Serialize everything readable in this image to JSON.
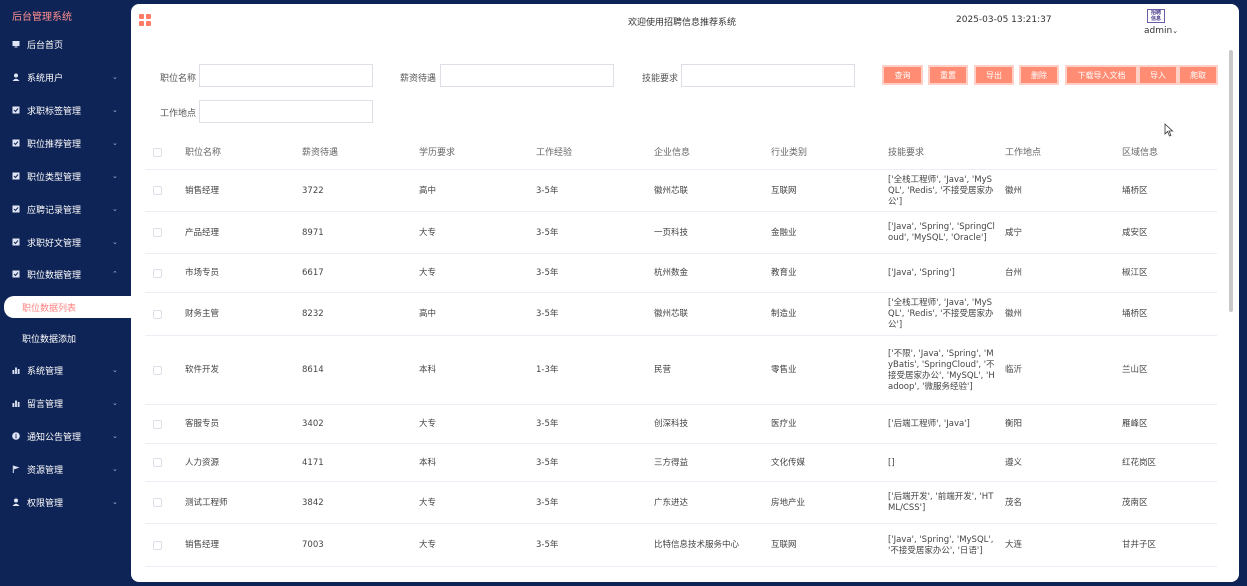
{
  "sidebar": {
    "title": "后台管理系统",
    "items": [
      {
        "label": "后台首页",
        "icon": "monitor-icon"
      },
      {
        "label": "系统用户",
        "icon": "user-icon"
      },
      {
        "label": "求职标签管理",
        "icon": "check-square-icon"
      },
      {
        "label": "职位推荐管理",
        "icon": "check-square-icon"
      },
      {
        "label": "职位类型管理",
        "icon": "check-square-icon"
      },
      {
        "label": "应聘记录管理",
        "icon": "check-square-icon"
      },
      {
        "label": "求职好文管理",
        "icon": "check-square-icon"
      },
      {
        "label": "职位数据管理",
        "icon": "check-square-icon"
      },
      {
        "label": "系统管理",
        "icon": "bar-chart-icon"
      },
      {
        "label": "留言管理",
        "icon": "bar-chart-icon"
      },
      {
        "label": "通知公告管理",
        "icon": "info-circle-icon"
      },
      {
        "label": "资源管理",
        "icon": "flag-icon"
      },
      {
        "label": "权限管理",
        "icon": "user-icon"
      }
    ],
    "subitems": [
      {
        "label": "职位数据列表"
      },
      {
        "label": "职位数据添加"
      }
    ]
  },
  "header": {
    "welcome": "欢迎使用招聘信息推荐系统",
    "datetime": "2025-03-05 13:21:37",
    "avatar_text": "招聘 信息",
    "user": "admin"
  },
  "search": {
    "job_name_label": "职位名称",
    "salary_label": "薪资待遇",
    "skills_label": "技能要求",
    "location_label": "工作地点",
    "job_name_value": "",
    "salary_value": "",
    "skills_value": "",
    "location_value": ""
  },
  "buttons": {
    "query": "查询",
    "reset": "重置",
    "export": "导出",
    "delete": "删除",
    "download_template": "下载导入文档",
    "import": "导入",
    "crawl": "爬取"
  },
  "table": {
    "columns": [
      "职位名称",
      "薪资待遇",
      "学历要求",
      "工作经验",
      "企业信息",
      "行业类别",
      "技能要求",
      "工作地点",
      "区域信息"
    ],
    "rows": [
      {
        "name": "销售经理",
        "salary": "3722",
        "edu": "高中",
        "exp": "3-5年",
        "company": "徽州芯联",
        "industry": "互联网",
        "skills": "['全栈工程师', 'Java', 'MySQL', 'Redis', '不接受居家办公']",
        "city": "徽州",
        "area": "埇桥区"
      },
      {
        "name": "产品经理",
        "salary": "8971",
        "edu": "大专",
        "exp": "3-5年",
        "company": "一页科技",
        "industry": "金融业",
        "skills": "['Java', 'Spring', 'SpringCloud', 'MySQL', 'Oracle']",
        "city": "咸宁",
        "area": "咸安区"
      },
      {
        "name": "市场专员",
        "salary": "6617",
        "edu": "大专",
        "exp": "3-5年",
        "company": "杭州数金",
        "industry": "教育业",
        "skills": "['Java', 'Spring']",
        "city": "台州",
        "area": "椒江区"
      },
      {
        "name": "财务主管",
        "salary": "8232",
        "edu": "高中",
        "exp": "3-5年",
        "company": "徽州芯联",
        "industry": "制造业",
        "skills": "['全栈工程师', 'Java', 'MySQL', 'Redis', '不接受居家办公']",
        "city": "徽州",
        "area": "埇桥区"
      },
      {
        "name": "软件开发",
        "salary": "8614",
        "edu": "本科",
        "exp": "1-3年",
        "company": "民营",
        "industry": "零售业",
        "skills": "['不限', 'Java', 'Spring', 'MyBatis', 'SpringCloud', '不接受居家办公', 'MySQL', 'Hadoop', '微服务经验']",
        "city": "临沂",
        "area": "兰山区"
      },
      {
        "name": "客服专员",
        "salary": "3402",
        "edu": "大专",
        "exp": "3-5年",
        "company": "创深科技",
        "industry": "医疗业",
        "skills": "['后端工程师', 'Java']",
        "city": "衡阳",
        "area": "雁峰区"
      },
      {
        "name": "人力资源",
        "salary": "4171",
        "edu": "本科",
        "exp": "3-5年",
        "company": "三方得益",
        "industry": "文化传媒",
        "skills": "[]",
        "city": "遵义",
        "area": "红花岗区"
      },
      {
        "name": "测试工程师",
        "salary": "3842",
        "edu": "大专",
        "exp": "3-5年",
        "company": "广东进达",
        "industry": "房地产业",
        "skills": "['后端开发', '前端开发', 'HTML/CSS']",
        "city": "茂名",
        "area": "茂南区"
      },
      {
        "name": "销售经理",
        "salary": "7003",
        "edu": "大专",
        "exp": "3-5年",
        "company": "比特信息技术服务中心",
        "industry": "互联网",
        "skills": "['Java', 'Spring', 'MySQL', '不接受居家办公', '日语']",
        "city": "大连",
        "area": "甘井子区"
      }
    ]
  }
}
